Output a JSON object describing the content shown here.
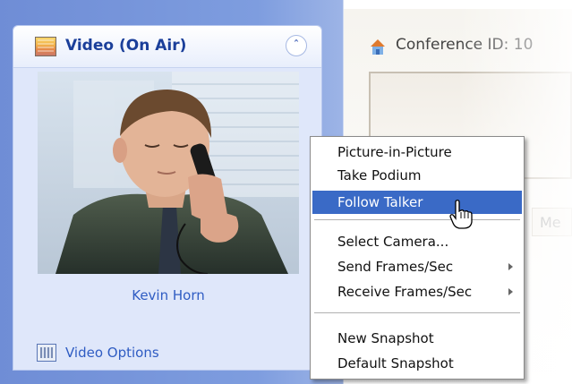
{
  "video_panel": {
    "title": "Video (On Air)",
    "caller_name": "Kevin Horn",
    "options_label": "Video Options",
    "icons": {
      "video": "video-screen-icon",
      "collapse": "double-chevron-up-icon",
      "options": "video-options-icon"
    }
  },
  "conference": {
    "label": "Conference ID: 10",
    "icon": "conference-house-icon",
    "ghost_button_text": "Me"
  },
  "context_menu": {
    "items": [
      {
        "label": "Picture-in-Picture",
        "submenu": false
      },
      {
        "label": "Take Podium",
        "submenu": false
      },
      {
        "label": "Follow Talker",
        "submenu": false,
        "highlighted": true
      },
      {
        "label": "Select Camera...",
        "submenu": false
      },
      {
        "label": "Send Frames/Sec",
        "submenu": true
      },
      {
        "label": "Receive Frames/Sec",
        "submenu": true
      },
      {
        "label": "New Snapshot",
        "submenu": false
      },
      {
        "label": "Default Snapshot",
        "submenu": false
      }
    ]
  },
  "colors": {
    "accent_blue": "#2f5cc3",
    "title_blue": "#1b3f9a",
    "menu_highlight": "#3a6ac6"
  }
}
